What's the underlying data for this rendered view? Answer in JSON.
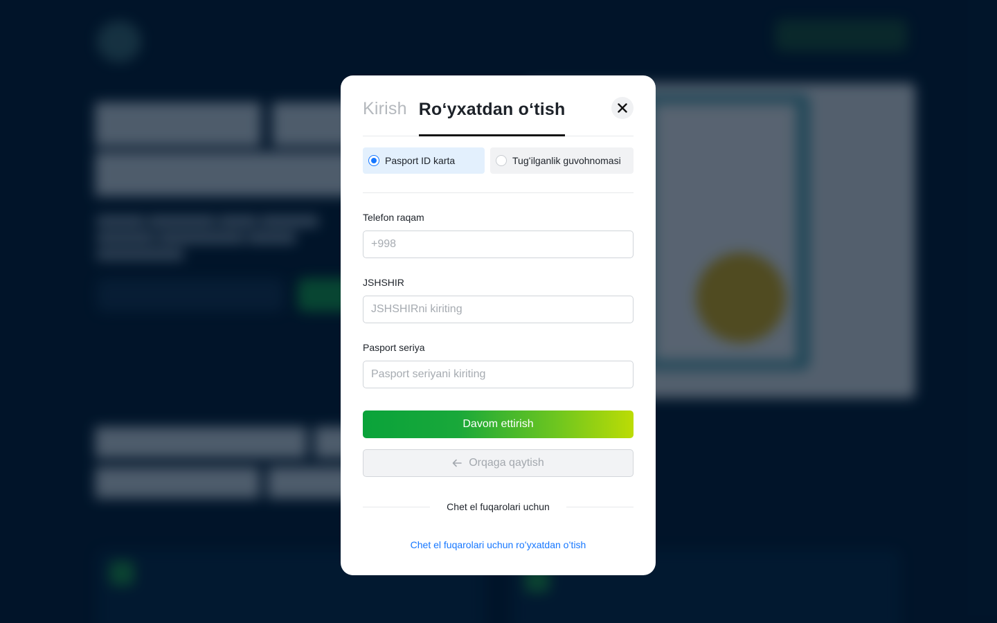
{
  "tabs": {
    "login_label": "Kirish",
    "register_label": "Roʻyxatdan oʻtish"
  },
  "close": {
    "icon": "close-icon"
  },
  "document_type": {
    "selected": "passport",
    "options": [
      {
        "key": "passport",
        "label": "Pasport ID karta"
      },
      {
        "key": "birth_certificate",
        "label": "Tugʻilganlik guvohnomasi"
      }
    ]
  },
  "form": {
    "phone": {
      "label": "Telefon raqam",
      "placeholder": "+998",
      "value": ""
    },
    "jshshir": {
      "label": "JSHSHIR",
      "placeholder": "JSHSHIRni kiriting",
      "value": ""
    },
    "passport_series": {
      "label": "Pasport seriya",
      "placeholder": "Pasport seriyani kiriting",
      "value": ""
    }
  },
  "actions": {
    "continue_label": "Davom ettirish",
    "back_label": "Orqaga qaytish",
    "back_icon": "arrow-left-icon"
  },
  "foreign": {
    "divider_text": "Chet el fuqarolari uchun",
    "link_label": "Chet el fuqarolari uchun roʻyxatdan oʻtish"
  },
  "colors": {
    "accent_blue": "#1677ff",
    "gradient_start": "#0aa33a",
    "gradient_end": "#bcdc05",
    "page_bg": "#021a31"
  }
}
